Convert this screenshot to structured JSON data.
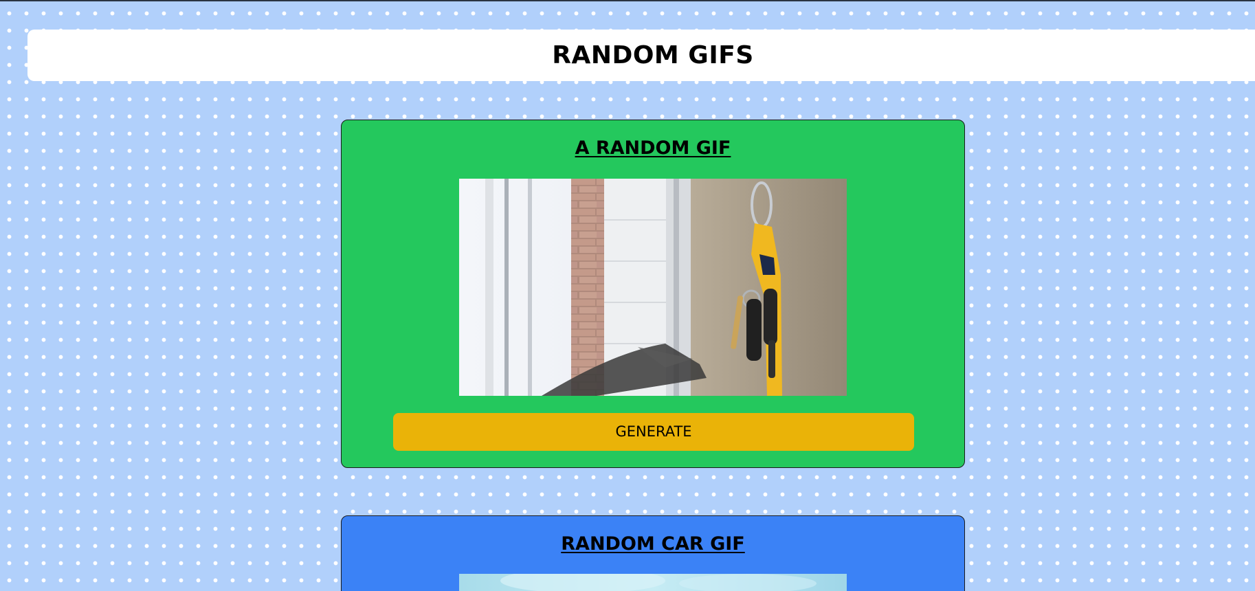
{
  "page": {
    "title": "RANDOM GIFS"
  },
  "cards": [
    {
      "title": "A RANDOM GIF",
      "button_label": "GENERATE",
      "background": "#24c85d",
      "button_color": "#eab308"
    },
    {
      "title": "RANDOM CAR GIF",
      "background": "#3b82f6"
    }
  ],
  "colors": {
    "page_background": "#b1d0fb",
    "dot": "#ffffff",
    "header_background": "#ffffff"
  }
}
